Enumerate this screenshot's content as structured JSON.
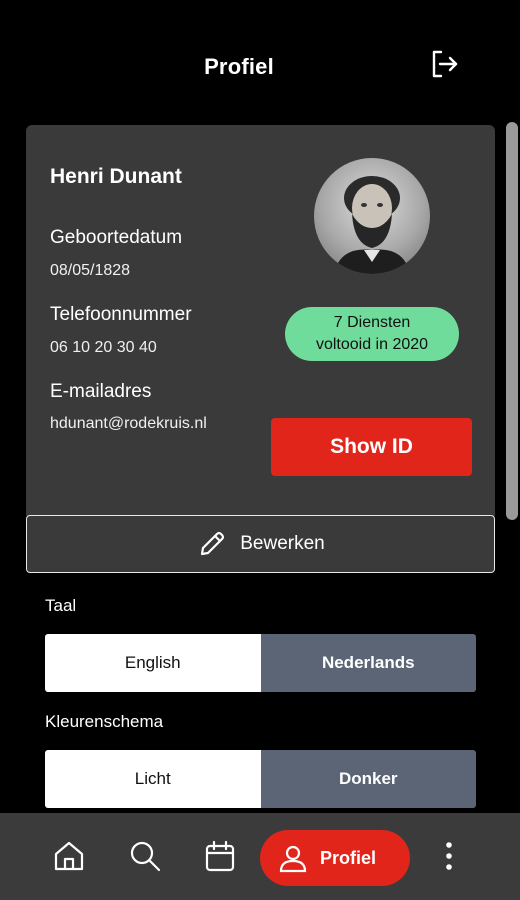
{
  "header": {
    "title": "Profiel",
    "logout_icon": "logout-icon"
  },
  "profile": {
    "name": "Henri Dunant",
    "birthdate_label": "Geboortedatum",
    "birthdate": "08/05/1828",
    "phone_label": "Telefoonnummer",
    "phone": "06 10 20 30 40",
    "email_label": "E-mailadres",
    "email": "hdunant@rodekruis.nl",
    "badge_line1": "7 Diensten",
    "badge_line2": "voltooid in 2020",
    "show_id_label": "Show ID"
  },
  "edit": {
    "label": "Bewerken",
    "icon": "pencil-icon"
  },
  "language": {
    "label": "Taal",
    "options": [
      "English",
      "Nederlands"
    ],
    "selected": "English"
  },
  "theme": {
    "label": "Kleurenschema",
    "options": [
      "Licht",
      "Donker"
    ],
    "selected": "Licht"
  },
  "nav": {
    "items": [
      "home-icon",
      "search-icon",
      "calendar-icon",
      "profile-icon",
      "more-icon"
    ],
    "active_label": "Profiel"
  },
  "colors": {
    "accent": "#e1251b",
    "badge": "#6fdc9c",
    "card": "#3a3a3a",
    "toggle_off": "#5b6575"
  }
}
